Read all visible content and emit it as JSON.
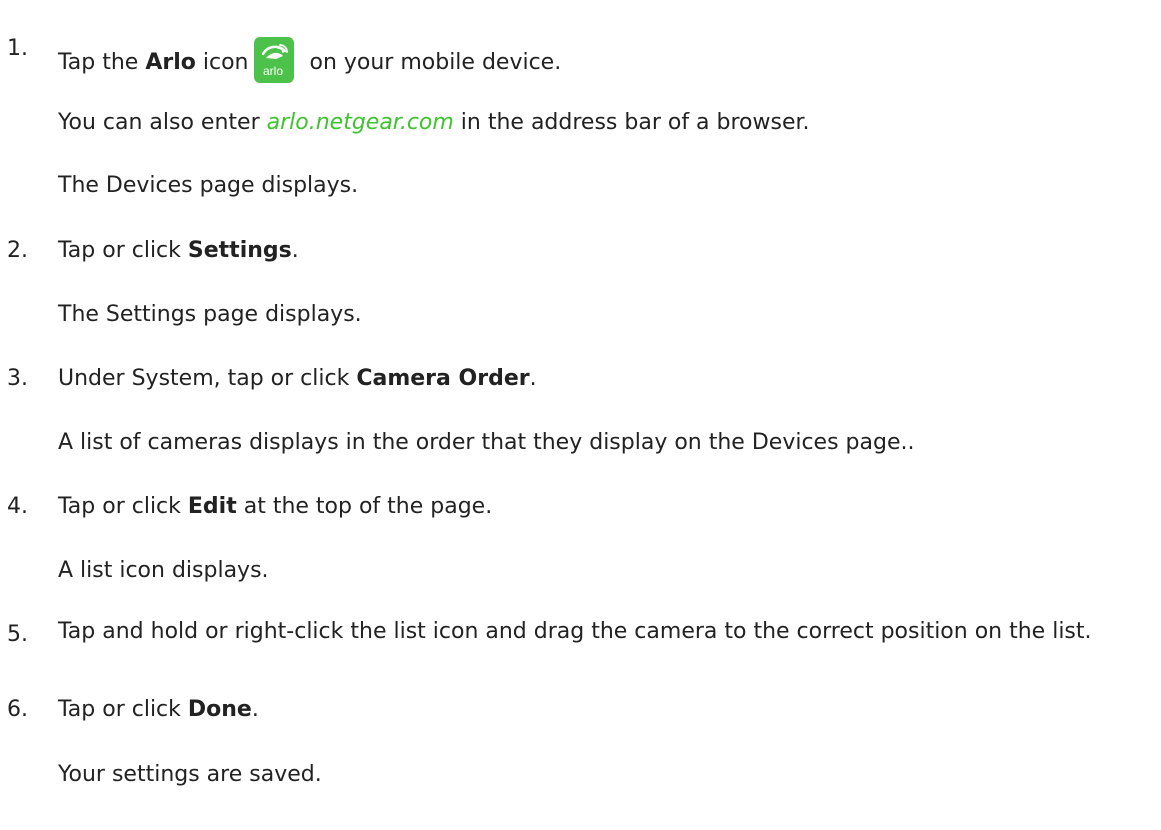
{
  "steps": [
    {
      "number": "1.",
      "pre": "Tap the ",
      "bold": "Arlo",
      "mid": " icon",
      "post": " on your mobile device.",
      "note1_pre": "You can also enter ",
      "note1_link": "arlo.netgear.com",
      "note1_post": " in the address bar of a browser.",
      "note2": "The Devices page displays."
    },
    {
      "number": "2.",
      "pre": "Tap or click ",
      "bold": "Settings",
      "post": ".",
      "note": "The Settings page displays."
    },
    {
      "number": "3.",
      "pre": "Under System, tap or click ",
      "bold": "Camera Order",
      "post": ".",
      "note": "A list of cameras displays in the order that they display on the Devices page.."
    },
    {
      "number": "4.",
      "pre": "Tap or click ",
      "bold": "Edit",
      "post": " at the top of the page.",
      "note": "A list icon displays."
    },
    {
      "number": "5.",
      "text": "Tap and hold or right-click the list icon and drag the camera to the correct position on the list."
    },
    {
      "number": "6.",
      "pre": "Tap or click ",
      "bold": "Done",
      "post": ".",
      "note": "Your settings are saved."
    }
  ],
  "icon": {
    "name": "arlo-app-icon",
    "label": "arlo",
    "color": "#4cc24a"
  },
  "colors": {
    "text": "#222222",
    "link": "#3ec42e"
  }
}
